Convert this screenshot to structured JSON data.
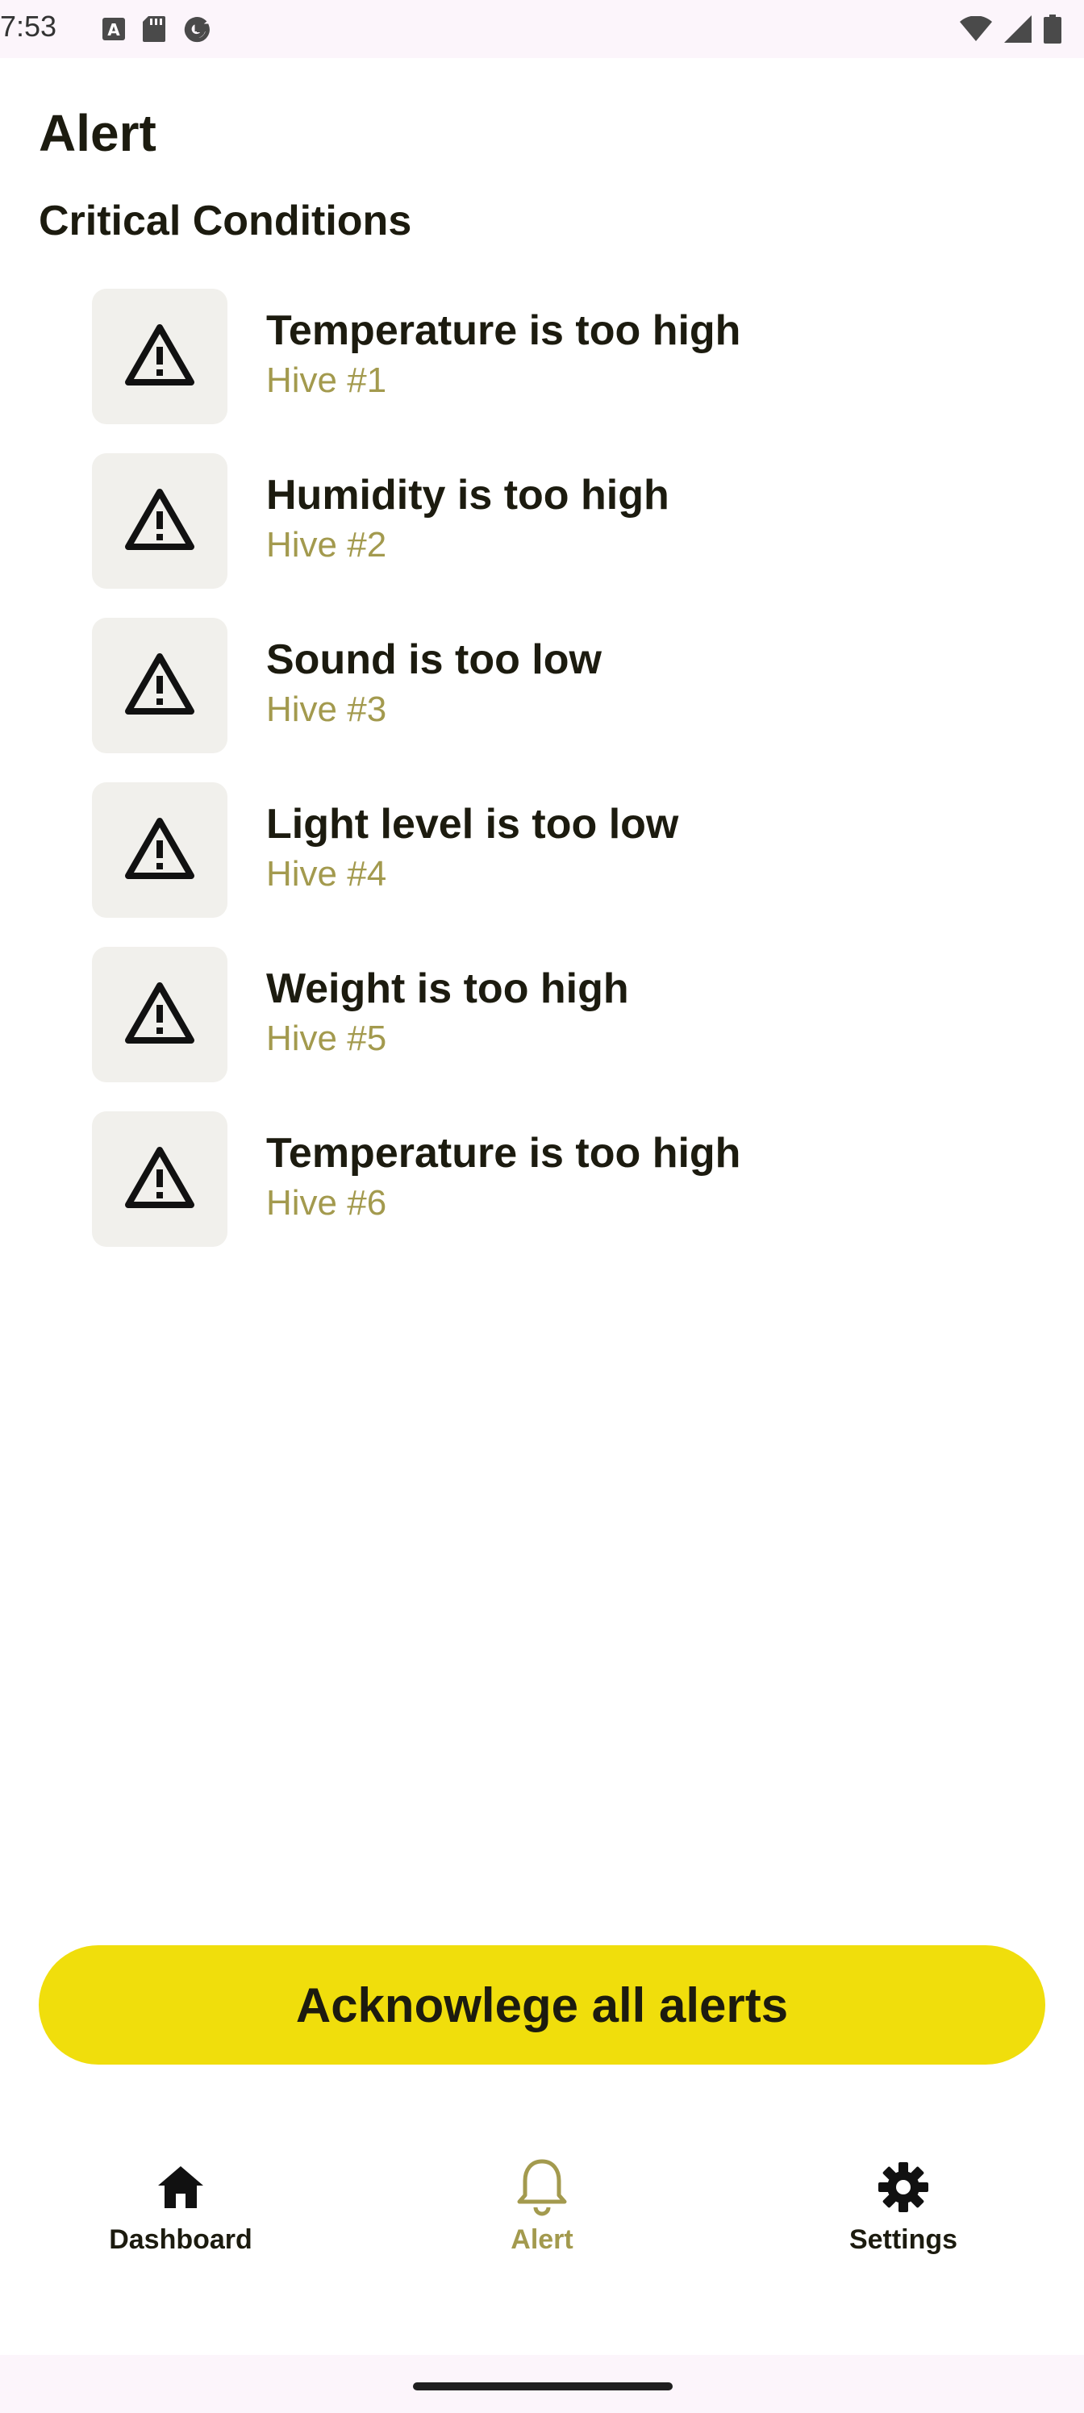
{
  "status_bar": {
    "time": "7:53",
    "icons": [
      "keyboard-a-icon",
      "sd-card-icon",
      "google-g-icon",
      "wifi-icon",
      "cell-signal-icon",
      "battery-icon"
    ]
  },
  "page": {
    "title": "Alert",
    "section_title": "Critical Conditions"
  },
  "alerts": [
    {
      "title": "Temperature is too high",
      "hive": "Hive #1",
      "icon": "warning-icon"
    },
    {
      "title": "Humidity is too high",
      "hive": "Hive #2",
      "icon": "warning-icon"
    },
    {
      "title": "Sound is too low",
      "hive": "Hive #3",
      "icon": "warning-icon"
    },
    {
      "title": "Light level is too low",
      "hive": "Hive #4",
      "icon": "warning-icon"
    },
    {
      "title": "Weight is too high",
      "hive": "Hive #5",
      "icon": "warning-icon"
    },
    {
      "title": "Temperature is too high",
      "hive": "Hive #6",
      "icon": "warning-icon"
    }
  ],
  "actions": {
    "acknowledge_label": "Acknowlege all alerts"
  },
  "bottom_nav": {
    "items": [
      {
        "label": "Dashboard",
        "icon": "home-icon",
        "active": false
      },
      {
        "label": "Alert",
        "icon": "bell-icon",
        "active": true
      },
      {
        "label": "Settings",
        "icon": "gear-icon",
        "active": false
      }
    ]
  },
  "colors": {
    "accent_yellow": "#f0de0c",
    "subtitle_olive": "#a39a4e",
    "icon_tile": "#f1f0ec",
    "text_dark": "#1c1b0f",
    "system_bar": "#fcf5fb"
  }
}
